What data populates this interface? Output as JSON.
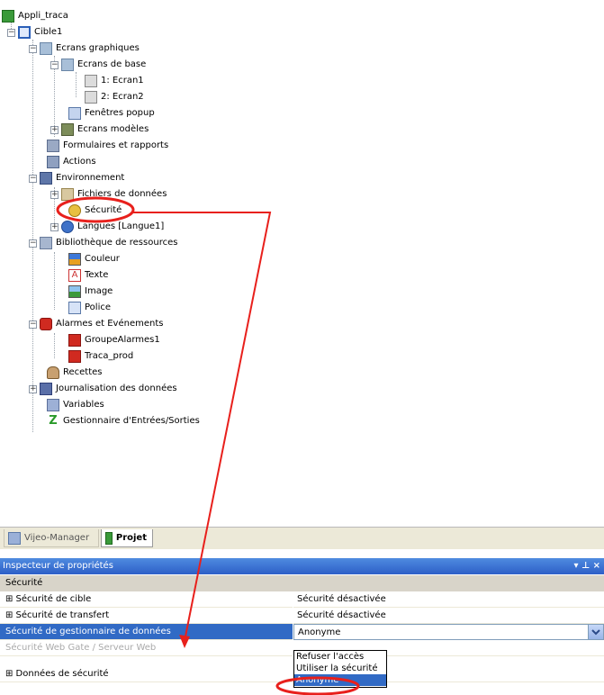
{
  "tree": {
    "root": "Appli_traca",
    "target": "Cible1",
    "graphic_screens": "Ecrans graphiques",
    "base_screens": "Ecrans de base",
    "screen1": "1: Ecran1",
    "screen2": "2: Ecran2",
    "popup_windows": "Fenêtres popup",
    "screen_templates": "Ecrans modèles",
    "forms_reports": "Formulaires et rapports",
    "actions": "Actions",
    "environment": "Environnement",
    "data_files": "Fichiers de données",
    "security": "Sécurité",
    "languages": "Langues [Langue1]",
    "resource_library": "Bibliothèque de ressources",
    "color": "Couleur",
    "text": "Texte",
    "image": "Image",
    "font": "Police",
    "alarms_events": "Alarmes et Evénements",
    "alarm_group": "GroupeAlarmes1",
    "traca_prod": "Traca_prod",
    "recipes": "Recettes",
    "data_logging": "Journalisation des données",
    "variables": "Variables",
    "io_manager": "Gestionnaire d'Entrées/Sorties"
  },
  "tabs": {
    "manager": "Vijeo-Manager",
    "project": "Projet"
  },
  "inspector": {
    "title": "Inspecteur de propriétés",
    "pin": "▾ ⊥ ×",
    "section": "Sécurité",
    "rows": [
      {
        "name": "⊞ Sécurité de cible",
        "value": "Sécurité désactivée"
      },
      {
        "name": "⊞ Sécurité de transfert",
        "value": "Sécurité désactivée"
      },
      {
        "name": "Sécurité de gestionnaire de données",
        "value": "Anonyme"
      },
      {
        "name": "Sécurité Web Gate / Serveur Web",
        "value": ""
      },
      {
        "name": "⊞ Données de sécurité",
        "value": ""
      }
    ]
  },
  "dropdown": {
    "options": [
      "Refuser l'accès",
      "Utiliser la sécurité",
      "Anonyme"
    ],
    "selected": "Anonyme"
  },
  "colors": {
    "annotation": "#e8201c",
    "selection": "#316ac5",
    "inspector_title": "#2d5fc7"
  }
}
